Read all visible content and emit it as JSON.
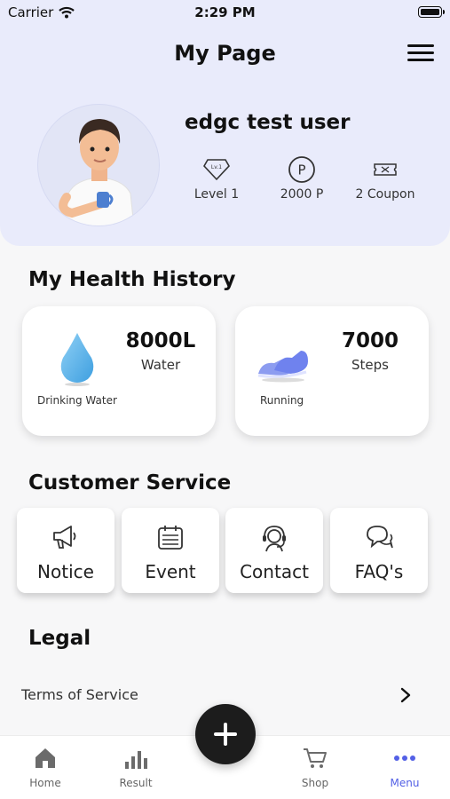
{
  "status_bar": {
    "carrier": "Carrier",
    "time": "2:29 PM"
  },
  "header": {
    "title": "My Page"
  },
  "profile": {
    "username": "edgc test user",
    "level": "Level 1",
    "level_badge": "Lv.1",
    "points": "2000 P",
    "points_badge": "P",
    "coupons": "2 Coupon"
  },
  "health": {
    "title": "My Health History",
    "water": {
      "value": "8000L",
      "unit": "Water",
      "caption": "Drinking Water"
    },
    "steps": {
      "value": "7000",
      "unit": "Steps",
      "caption": "Running"
    }
  },
  "customer_service": {
    "title": "Customer Service",
    "items": [
      {
        "label": "Notice",
        "icon": "megaphone-icon"
      },
      {
        "label": "Event",
        "icon": "calendar-icon"
      },
      {
        "label": "Contact",
        "icon": "headset-icon"
      },
      {
        "label": "FAQ's",
        "icon": "chat-bubbles-icon"
      }
    ]
  },
  "legal": {
    "title": "Legal",
    "terms": "Terms of Service"
  },
  "nav": {
    "home": "Home",
    "result": "Result",
    "shop": "Shop",
    "menu": "Menu",
    "active": "Menu"
  },
  "colors": {
    "header_bg": "#e9ebfb",
    "accent": "#5360e6",
    "fab": "#1c1c1c"
  }
}
